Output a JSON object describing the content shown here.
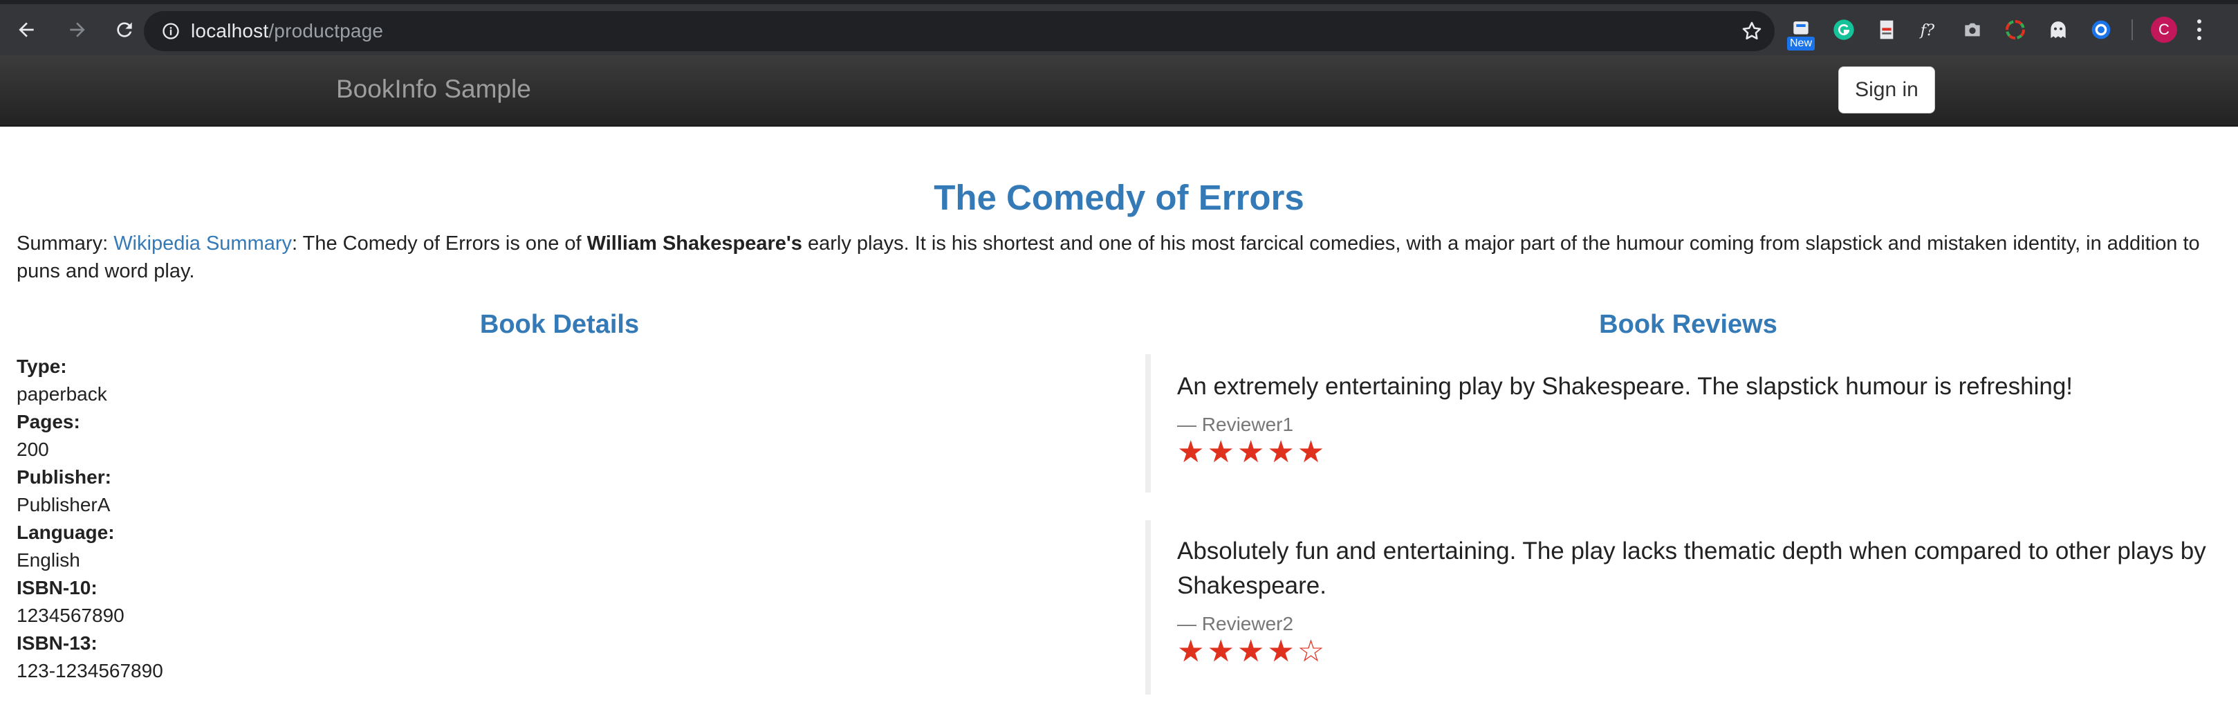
{
  "browser": {
    "url_host": "localhost",
    "url_path": "/productpage",
    "extension_badge": "New",
    "profile_initial": "C"
  },
  "navbar": {
    "brand": "BookInfo Sample",
    "signin_label": "Sign in"
  },
  "product": {
    "title": "The Comedy of Errors",
    "summary_prefix": "Summary: ",
    "summary_link": "Wikipedia Summary",
    "summary_text1": ": The Comedy of Errors is one of ",
    "summary_bold": "William Shakespeare's",
    "summary_text2": " early plays. It is his shortest and one of his most farcical comedies, with a major part of the humour coming from slapstick and mistaken identity, in addition to puns and word play."
  },
  "details": {
    "heading": "Book Details",
    "items": [
      {
        "label": "Type:",
        "value": "paperback"
      },
      {
        "label": "Pages:",
        "value": "200"
      },
      {
        "label": "Publisher:",
        "value": "PublisherA"
      },
      {
        "label": "Language:",
        "value": "English"
      },
      {
        "label": "ISBN-10:",
        "value": "1234567890"
      },
      {
        "label": "ISBN-13:",
        "value": "123-1234567890"
      }
    ]
  },
  "reviews": {
    "heading": "Book Reviews",
    "items": [
      {
        "text": "An extremely entertaining play by Shakespeare. The slapstick humour is refreshing!",
        "author": "— Reviewer1",
        "rating": 5,
        "stars": "★★★★★"
      },
      {
        "text": "Absolutely fun and entertaining. The play lacks thematic depth when compared to other plays by Shakespeare.",
        "author": "— Reviewer2",
        "rating": 4,
        "stars": "★★★★☆"
      }
    ]
  },
  "colors": {
    "accent": "#337ab7",
    "star": "#e0301e",
    "navbar": "#222222"
  }
}
